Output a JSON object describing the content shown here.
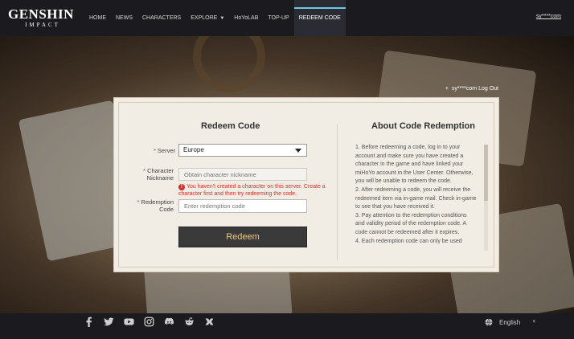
{
  "brand": {
    "line1": "GENSHIN",
    "line2": "IMPACT"
  },
  "nav": {
    "items": [
      {
        "label": "HOME"
      },
      {
        "label": "NEWS"
      },
      {
        "label": "CHARACTERS"
      },
      {
        "label": "EXPLORE"
      },
      {
        "label": "HoYoLAB"
      },
      {
        "label": "TOP-UP"
      },
      {
        "label": "REDEEM CODE"
      }
    ],
    "active": "REDEEM CODE",
    "user": "sy****com"
  },
  "account_bar": {
    "plus": "+",
    "user": "sy****com",
    "logout": "Log Out"
  },
  "form": {
    "title": "Redeem Code",
    "server_label": "Server",
    "server_value": "Europe",
    "nickname_label_1": "Character",
    "nickname_label_2": "Nickname",
    "nickname_placeholder": "Obtain character nickname",
    "error_text": "You haven't created a character on this server. Create a character first and then try redeeming the code.",
    "code_label_1": "Redemption",
    "code_label_2": "Code",
    "code_placeholder": "Enter redemption code",
    "button": "Redeem",
    "required_mark": "*"
  },
  "about": {
    "title": "About Code Redemption",
    "text": "1. Before redeeming a code, log in to your account and make sure you have created a character in the game and have linked your miHoYo account in the User Center. Otherwise, you will be unable to redeem the code.\n2. After redeeming a code, you will receive the redeemed item via in-game mail. Check in-game to see that you have received it.\n3. Pay attention to the redemption conditions and validity period of the redemption code. A code cannot be redeemed after it expires.\n4. Each redemption code can only be used"
  },
  "footer": {
    "icons": [
      "facebook-icon",
      "twitter-icon",
      "youtube-icon",
      "instagram-icon",
      "discord-icon",
      "reddit-icon",
      "hoyolab-icon"
    ],
    "language": "English"
  }
}
